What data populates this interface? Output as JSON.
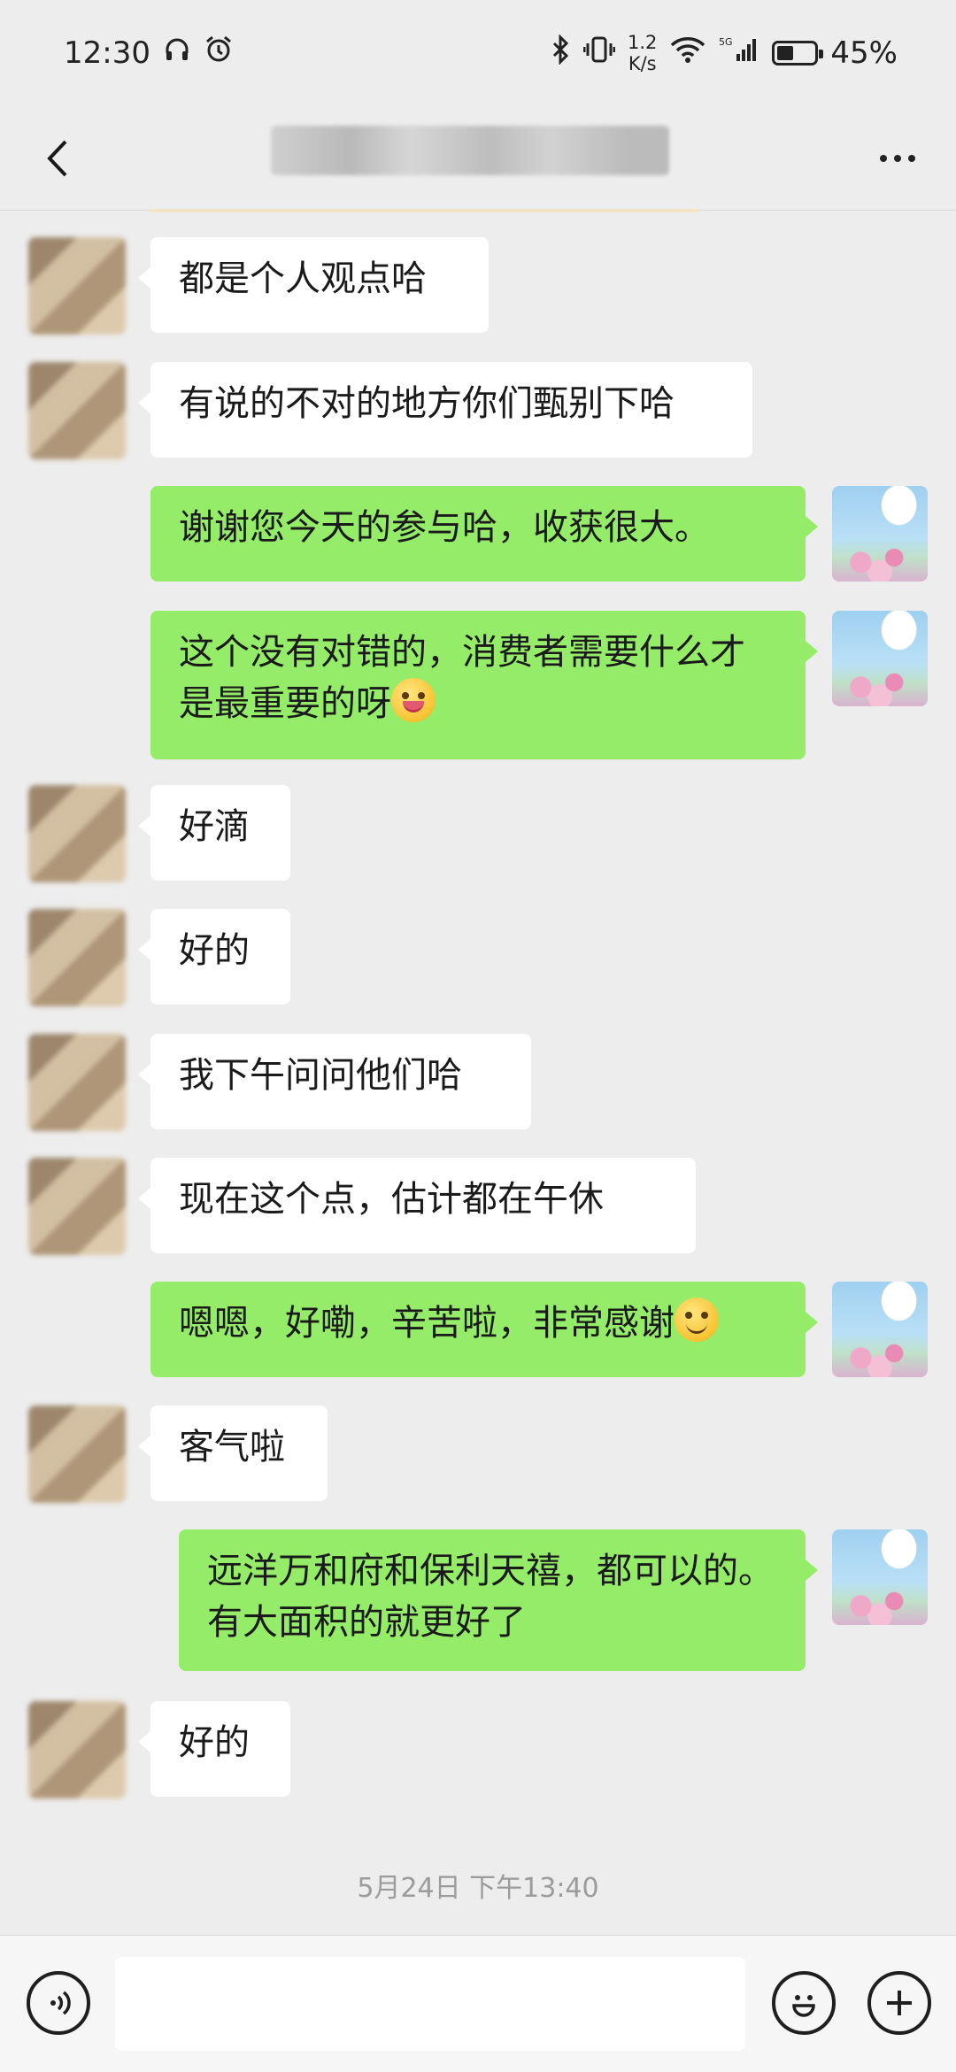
{
  "status_bar": {
    "time": "12:30",
    "net_speed_value": "1.2",
    "net_speed_unit": "K/s",
    "battery": "45%",
    "battery_level": 0.45
  },
  "header": {
    "title": "",
    "back_icon": "chevron-left-icon",
    "more_icon": "more-dots-icon"
  },
  "messages": [
    {
      "side": "in",
      "text": "都是个人观点哈"
    },
    {
      "side": "in",
      "text": "有说的不对的地方你们甄别下哈"
    },
    {
      "side": "out",
      "text": "谢谢您今天的参与哈，收获很大。"
    },
    {
      "side": "out",
      "text": "这个没有对错的，消费者需要什么才是最重要的呀",
      "emoji": "winking-face"
    },
    {
      "side": "in",
      "text": "好滴"
    },
    {
      "side": "in",
      "text": "好的"
    },
    {
      "side": "in",
      "text": "我下午问问他们哈"
    },
    {
      "side": "in",
      "text": "现在这个点，估计都在午休"
    },
    {
      "side": "out",
      "text": "嗯嗯，好嘞，辛苦啦，非常感谢",
      "emoji": "smiling-face"
    },
    {
      "side": "in",
      "text": "客气啦"
    },
    {
      "side": "out",
      "text": "远洋万和府和保利天禧，都可以的。有大面积的就更好了"
    },
    {
      "side": "in",
      "text": "好的"
    }
  ],
  "timestamp": "5月24日 下午13:40",
  "input": {
    "value": "",
    "voice_icon": "voice-icon",
    "emoji_icon": "emoji-icon",
    "plus_icon": "plus-icon"
  },
  "colors": {
    "background": "#ededed",
    "incoming_bubble": "#ffffff",
    "outgoing_bubble": "#95ec69"
  }
}
